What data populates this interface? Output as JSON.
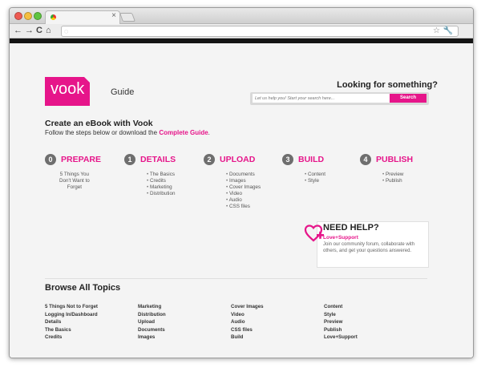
{
  "browser": {
    "tab_close": "×",
    "nav_back": "←",
    "nav_forward": "→",
    "nav_reload": "C",
    "nav_home": "⌂",
    "dot_colors": [
      "#ee5a52",
      "#f5be3f",
      "#5fc441"
    ]
  },
  "header": {
    "logo_text": "vook",
    "guide_label": "Guide",
    "looking_text": "Looking for something?",
    "search_placeholder": "Let us help you! Start your search here...",
    "search_button": "Search"
  },
  "intro": {
    "title": "Create an eBook with Vook",
    "follow_text": "Follow the steps below or download the ",
    "guide_link": "Complete Guide",
    "follow_end": "."
  },
  "steps": [
    {
      "num": "0",
      "title": "PREPARE",
      "items": [
        "5 Things You",
        "Don't Want to",
        "Forget"
      ]
    },
    {
      "num": "1",
      "title": "DETAILS",
      "items": [
        "The Basics",
        "Credits",
        "Marketing",
        "Distribution"
      ]
    },
    {
      "num": "2",
      "title": "UPLOAD",
      "items": [
        "Documents",
        "Images",
        "Cover Images",
        "Video",
        "Audio",
        "CSS files"
      ]
    },
    {
      "num": "3",
      "title": "BUILD",
      "items": [
        "Content",
        "Style"
      ]
    },
    {
      "num": "4",
      "title": "PUBLISH",
      "items": [
        "Preview",
        "Publish"
      ]
    }
  ],
  "help": {
    "title": "NEED HELP?",
    "subtitle": "Love+Support",
    "text": "Join our community forum, collaborate with others, and get your questions answered."
  },
  "topics": {
    "title": "Browse All Topics",
    "columns": [
      [
        "5 Things Not to Forget",
        "Logging In/Dashboard",
        "Details",
        "The Basics",
        "Credits"
      ],
      [
        "Marketing",
        "Distribution",
        "Upload",
        "Documents",
        "Images"
      ],
      [
        "Cover Images",
        "Video",
        "Audio",
        "CSS files",
        "Build"
      ],
      [
        "Content",
        "Style",
        "Preview",
        "Publish",
        "Love+Support"
      ]
    ]
  },
  "colors": {
    "accent": "#e6158a",
    "step_circle": "#6e6e6e",
    "page_bg": "#f4f4f4"
  }
}
